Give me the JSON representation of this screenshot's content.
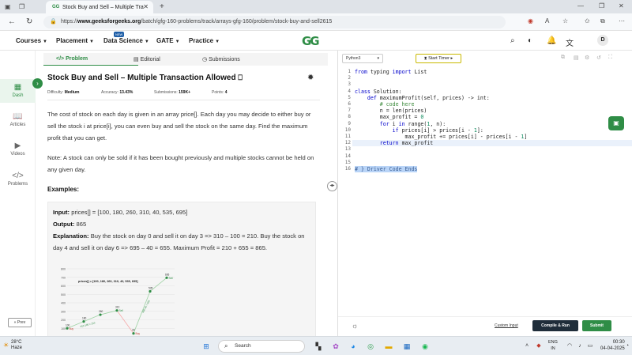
{
  "browser": {
    "tab_title": "Stock Buy and Sell – Multiple Tra",
    "url_prefix": "https://",
    "url_domain": "www.geeksforgeeks.org",
    "url_path": "/batch/gfg-160-problems/track/arrays-gfg-160/problem/stock-buy-and-sell2615"
  },
  "header": {
    "logo": "GG",
    "nav": [
      {
        "label": "Courses"
      },
      {
        "label": "Placement"
      },
      {
        "label": "Data Science"
      },
      {
        "label": "GATE"
      },
      {
        "label": "Practice"
      }
    ],
    "new_badge": "NEW",
    "avatar": "D"
  },
  "sidebar": {
    "items": [
      {
        "label": "Dash",
        "icon": "dashboard-icon"
      },
      {
        "label": "Articles",
        "icon": "book-icon"
      },
      {
        "label": "Videos",
        "icon": "video-icon"
      },
      {
        "label": "Problems",
        "icon": "code-icon"
      }
    ],
    "prev": "« Prev"
  },
  "problem_tabs": [
    {
      "label": "Problem"
    },
    {
      "label": "Editorial"
    },
    {
      "label": "Submissions"
    }
  ],
  "problem": {
    "title": "Stock Buy and Sell – Multiple Transaction Allowed",
    "difficulty_label": "Difficulty:",
    "difficulty": "Medium",
    "accuracy_label": "Accuracy:",
    "accuracy": "13.43%",
    "submissions_label": "Submissions:",
    "submissions": "159K+",
    "points_label": "Points:",
    "points": "4",
    "desc1": "The cost of stock on each day is given in an array price[]. Each day you may decide to either buy or sell the stock i at price[i], you can even buy and sell the stock on the same day. Find the maximum profit that you can get.",
    "desc2": "Note: A stock can only be sold if it has been bought previously and multiple stocks cannot be held on any given day.",
    "examples_heading": "Examples:",
    "example1": {
      "input_label": "Input:",
      "input": "prices[] = [100, 180, 260, 310, 40, 535, 695]",
      "output_label": "Output:",
      "output": "865",
      "explanation_label": "Explanation:",
      "explanation": "Buy the stock on day 0 and sell it on day 3 => 310 – 100 = 210. Buy the stock on day 4 and sell it on day 6 => 695 – 40 = 655. Maximum Profit = 210 + 655 = 865."
    }
  },
  "chart_data": {
    "type": "line",
    "title": "prices[] = [100, 180, 260, 310, 40, 535, 695]",
    "x": [
      0,
      1,
      2,
      3,
      4,
      5,
      6
    ],
    "values": [
      100,
      180,
      260,
      310,
      40,
      535,
      695
    ],
    "y_ticks": [
      800,
      700,
      600,
      500,
      400,
      300,
      200,
      100,
      0
    ],
    "ylim": [
      0,
      800
    ],
    "annotations": [
      {
        "index": 0,
        "label": "Buy"
      },
      {
        "index": 3,
        "label": "Sell"
      },
      {
        "index": 4,
        "label": "Buy"
      },
      {
        "index": 6,
        "label": "Sell"
      }
    ],
    "segment_labels": [
      "310-100 = 210",
      "695-40 = 655"
    ]
  },
  "editor": {
    "language": "Python3",
    "start_timer": "Start Timer",
    "lines": [
      "from typing import List",
      "",
      "",
      "class Solution:",
      "    def maximumProfit(self, prices) -> int:",
      "        # code here",
      "        n = len(prices)",
      "        max_profit = 0",
      "        for i in range(1, n):",
      "            if prices[i] > prices[i - 1]:",
      "                max_profit += prices[i] - prices[i - 1]",
      "        return max_profit",
      "",
      "",
      "",
      "# } Driver Code Ends"
    ],
    "custom_input": "Custom Input",
    "compile": "Compile & Run",
    "submit": "Submit"
  },
  "taskbar": {
    "temp": "28°C",
    "weather": "Haze",
    "search": "Search",
    "lang1": "ENG",
    "lang2": "IN",
    "time": "00:30",
    "date": "04-04-2025"
  }
}
